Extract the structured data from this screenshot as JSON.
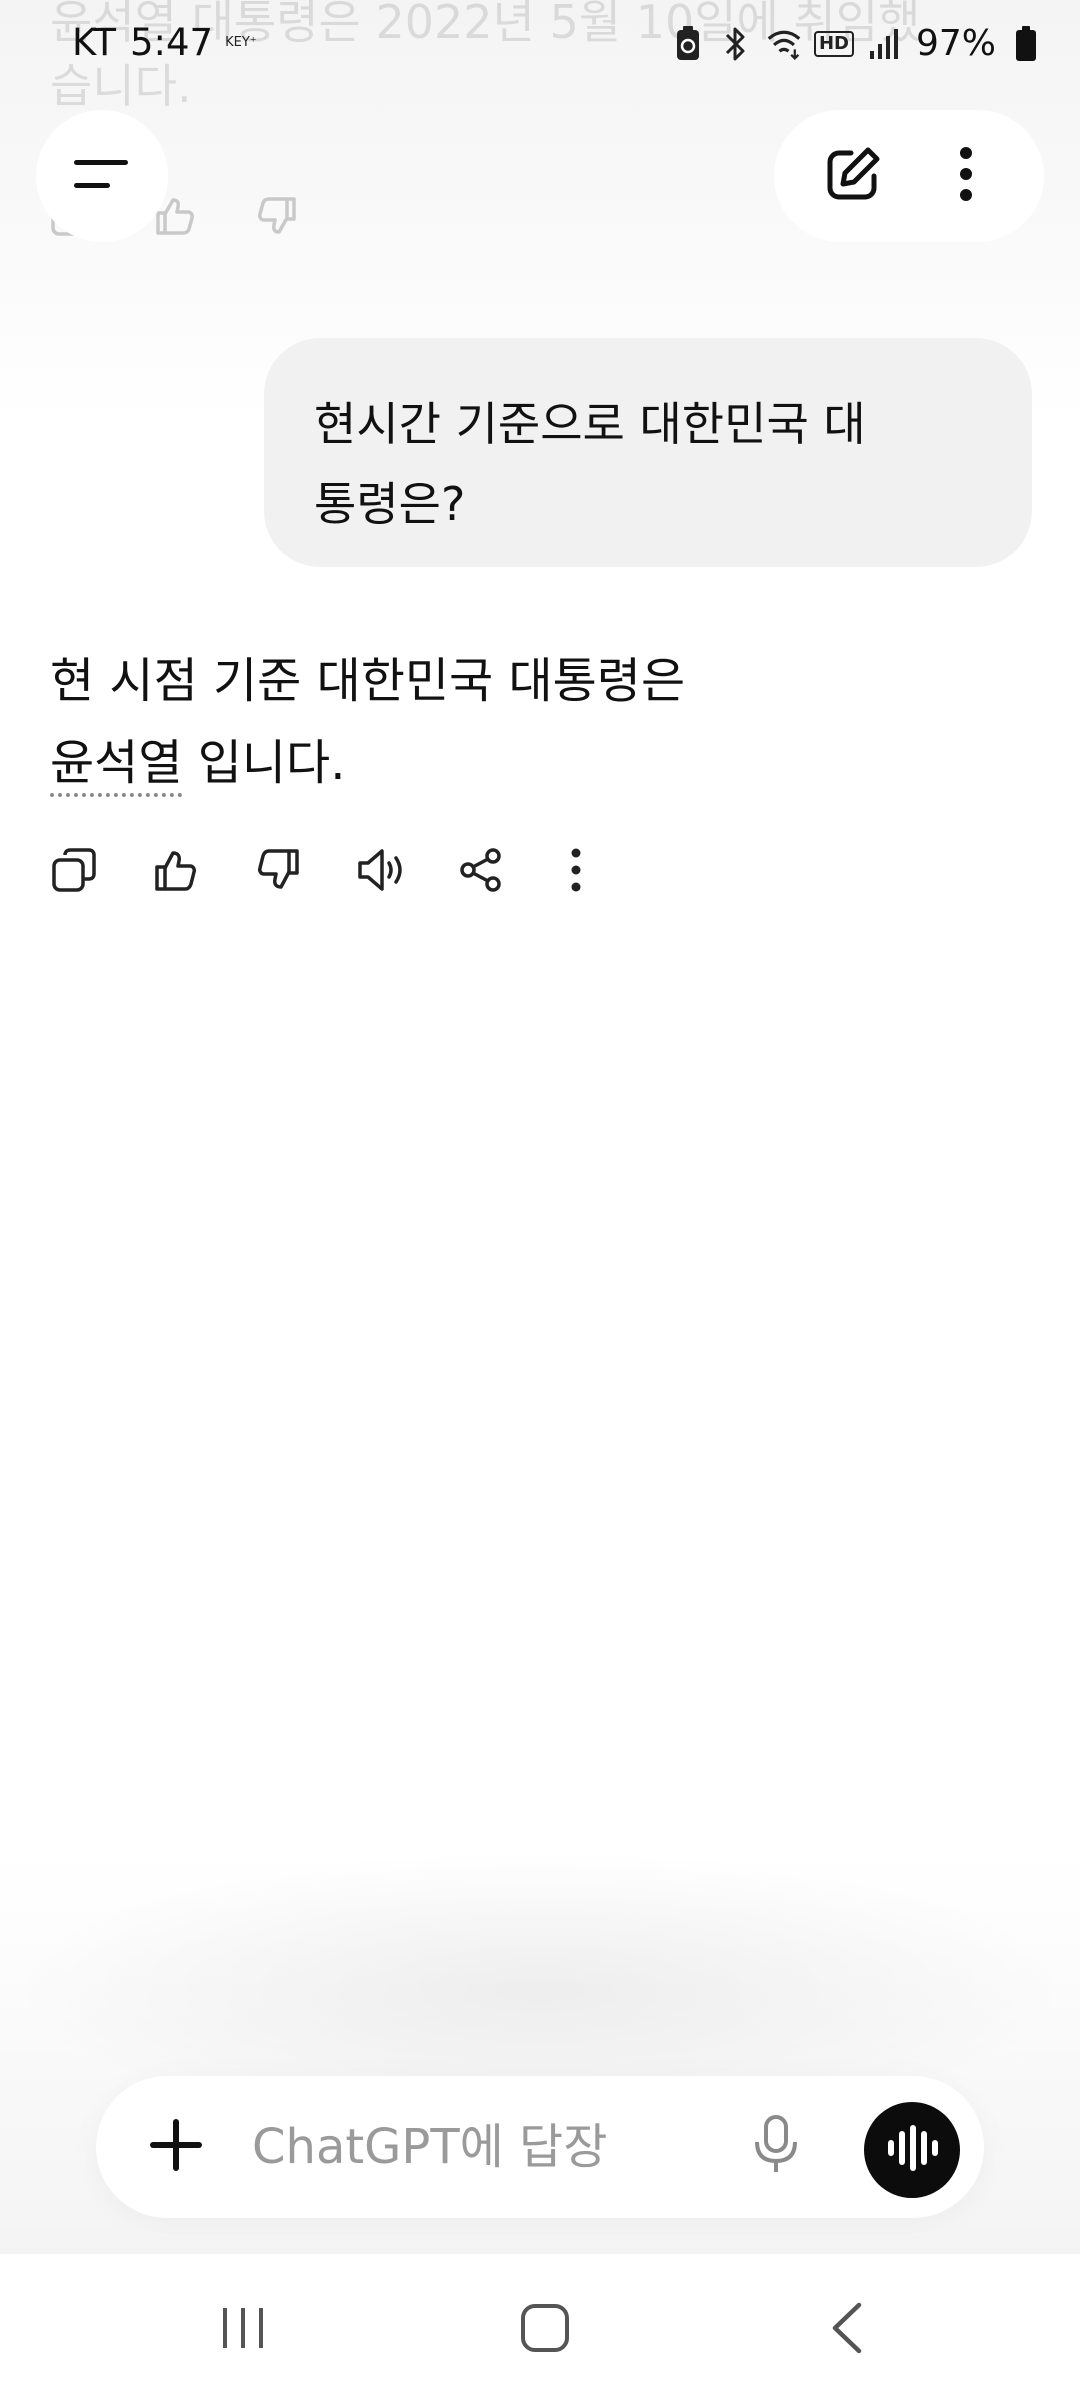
{
  "status_bar": {
    "carrier": "KT",
    "time": "5:47",
    "key_badge": "KEY⁺",
    "hd_label": "HD",
    "battery_percent": "97%"
  },
  "ghost": {
    "previous_text": "윤석열 대통령은 2022년 5월 10일에 취임했습니다."
  },
  "conversation": {
    "user_message": "현시간 기준으로 대한민국 대통령은?",
    "assistant_line1": "현 시점 기준 대한민국 대통령은",
    "assistant_name": "윤석열",
    "assistant_rest": " 입니다."
  },
  "composer": {
    "placeholder": "ChatGPT에 답장"
  },
  "colors": {
    "voice_button": "#0c0c0c",
    "user_bubble": "#f1f1f1"
  }
}
